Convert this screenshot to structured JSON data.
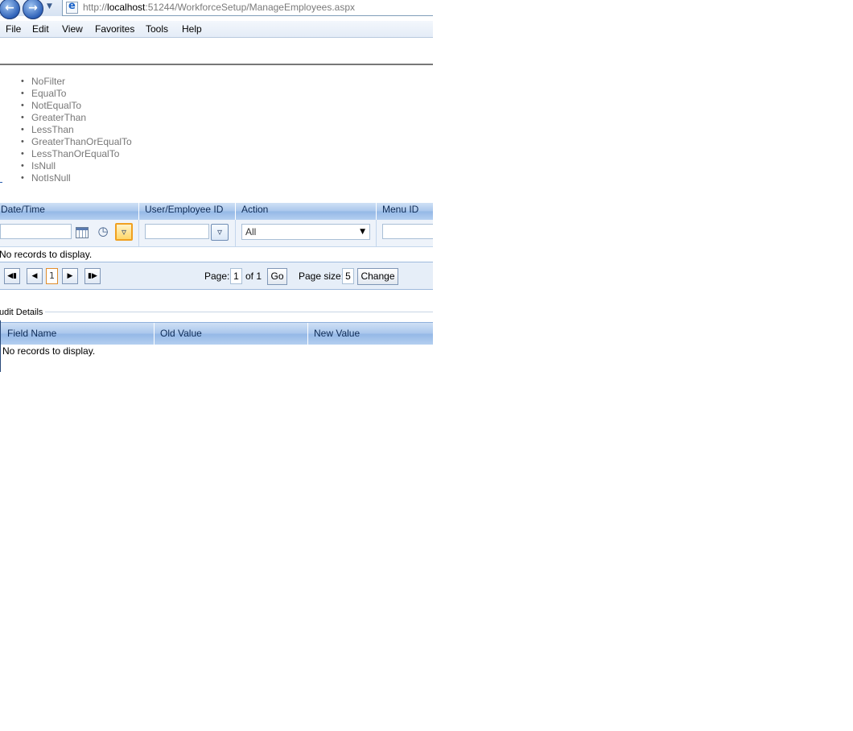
{
  "browser": {
    "url_prefix": "http://",
    "url_host": "localhost",
    "url_rest": ":51244/WorkforceSetup/ManageEmployees.aspx",
    "back_icon": "back-arrow-icon",
    "forward_icon": "forward-arrow-icon"
  },
  "menu": [
    "File",
    "Edit",
    "View",
    "Favorites",
    "Tools",
    "Help"
  ],
  "filter_options": [
    "NoFilter",
    "EqualTo",
    "NotEqualTo",
    "GreaterThan",
    "LessThan",
    "GreaterThanOrEqualTo",
    "LessThanOrEqualTo",
    "IsNull",
    "NotIsNull"
  ],
  "grid": {
    "columns": [
      "Date/Time",
      "User/Employee ID",
      "Action",
      "Menu ID"
    ],
    "action_filter_value": "All",
    "no_records": "No records to display.",
    "pager": {
      "current_page": "1",
      "page_label": "Page:",
      "page_value": "1",
      "of_label": "of 1",
      "go_label": "Go",
      "page_size_label": "Page size:",
      "page_size_value": "5",
      "change_label": "Change"
    }
  },
  "audit": {
    "legend": "udit Details",
    "columns": [
      "Field Name",
      "Old Value",
      "New Value"
    ],
    "no_records": "No records to display."
  },
  "colors": {
    "header_blue": "#a9c6ec",
    "active_filter": "#f0a020"
  }
}
